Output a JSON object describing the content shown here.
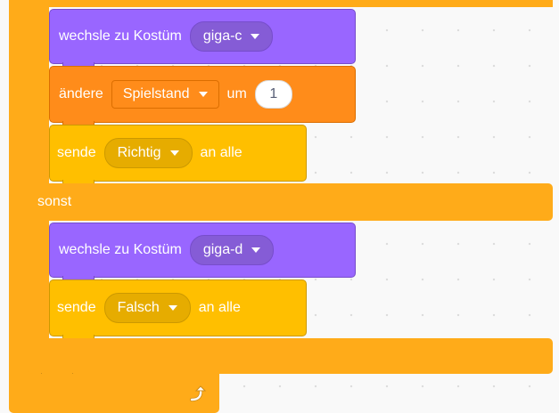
{
  "blocks": {
    "switch_costume_1": {
      "label": "wechsle zu Kostüm",
      "costume": "giga-c"
    },
    "change_var": {
      "label": "ändere",
      "variable": "Spielstand",
      "by_label": "um",
      "value": "1"
    },
    "broadcast_1": {
      "label": "sende",
      "message": "Richtig",
      "suffix": "an alle"
    },
    "else_label": "sonst",
    "switch_costume_2": {
      "label": "wechsle zu Kostüm",
      "costume": "giga-d"
    },
    "broadcast_2": {
      "label": "sende",
      "message": "Falsch",
      "suffix": "an alle"
    }
  },
  "icons": {
    "loop": "loop-arrow-icon",
    "dropdown": "caret-down-icon"
  },
  "colors": {
    "control": "#ffab19",
    "looks": "#9966ff",
    "variables": "#ff8c1a",
    "events": "#ffbf00",
    "background": "#f9f9f9"
  }
}
